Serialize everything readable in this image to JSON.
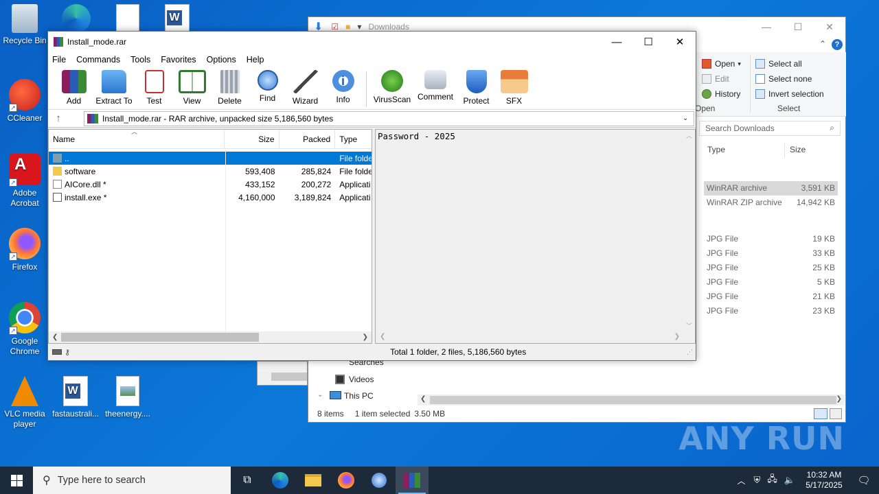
{
  "desktop": {
    "icons": [
      {
        "label": "Recycle Bin"
      },
      {
        "label": "CCleaner"
      },
      {
        "label": "Adobe Acrobat"
      },
      {
        "label": "Firefox"
      },
      {
        "label": "Google Chrome"
      },
      {
        "label": "VLC media player"
      },
      {
        "label": "fastaustrali..."
      },
      {
        "label": "theenergy...."
      }
    ]
  },
  "explorer": {
    "title": "Downloads",
    "ribbon": {
      "open_label": "Open",
      "edit_label": "Edit",
      "history_label": "History",
      "open_group": "Open",
      "select_all": "Select all",
      "select_none": "Select none",
      "invert_selection": "Invert selection",
      "select_group": "Select"
    },
    "search_placeholder": "Search Downloads",
    "columns": {
      "type": "Type",
      "size": "Size"
    },
    "rows": [
      {
        "type": "WinRAR archive",
        "size": "3,591 KB"
      },
      {
        "type": "WinRAR ZIP archive",
        "size": "14,942 KB"
      },
      {
        "type": "JPG File",
        "size": "19 KB"
      },
      {
        "type": "JPG File",
        "size": "33 KB"
      },
      {
        "type": "JPG File",
        "size": "25 KB"
      },
      {
        "type": "JPG File",
        "size": "5 KB"
      },
      {
        "type": "JPG File",
        "size": "21 KB"
      },
      {
        "type": "JPG File",
        "size": "23 KB"
      }
    ],
    "nav": {
      "searches": "Searches",
      "videos": "Videos",
      "this_pc": "This PC"
    },
    "status": {
      "items": "8 items",
      "selected": "1 item selected",
      "size": "3.50 MB"
    }
  },
  "winrar": {
    "title": "Install_mode.rar",
    "menu": [
      "File",
      "Commands",
      "Tools",
      "Favorites",
      "Options",
      "Help"
    ],
    "toolbar": [
      "Add",
      "Extract To",
      "Test",
      "View",
      "Delete",
      "Find",
      "Wizard",
      "Info",
      "VirusScan",
      "Comment",
      "Protect",
      "SFX"
    ],
    "path": "Install_mode.rar - RAR archive, unpacked size 5,186,560 bytes",
    "columns": {
      "name": "Name",
      "size": "Size",
      "packed": "Packed",
      "type": "Type"
    },
    "files": [
      {
        "name": "..",
        "size": "",
        "packed": "",
        "type": "File folde"
      },
      {
        "name": "software",
        "size": "593,408",
        "packed": "285,824",
        "type": "File folde"
      },
      {
        "name": "AICore.dll *",
        "size": "433,152",
        "packed": "200,272",
        "type": "Applicati"
      },
      {
        "name": "install.exe *",
        "size": "4,160,000",
        "packed": "3,189,824",
        "type": "Applicati"
      }
    ],
    "comment": "Password - 2025",
    "status": "Total 1 folder, 2 files, 5,186,560 bytes"
  },
  "taskbar": {
    "search_placeholder": "Type here to search",
    "time": "10:32 AM",
    "date": "5/17/2025"
  },
  "watermark": "ANY RUN"
}
